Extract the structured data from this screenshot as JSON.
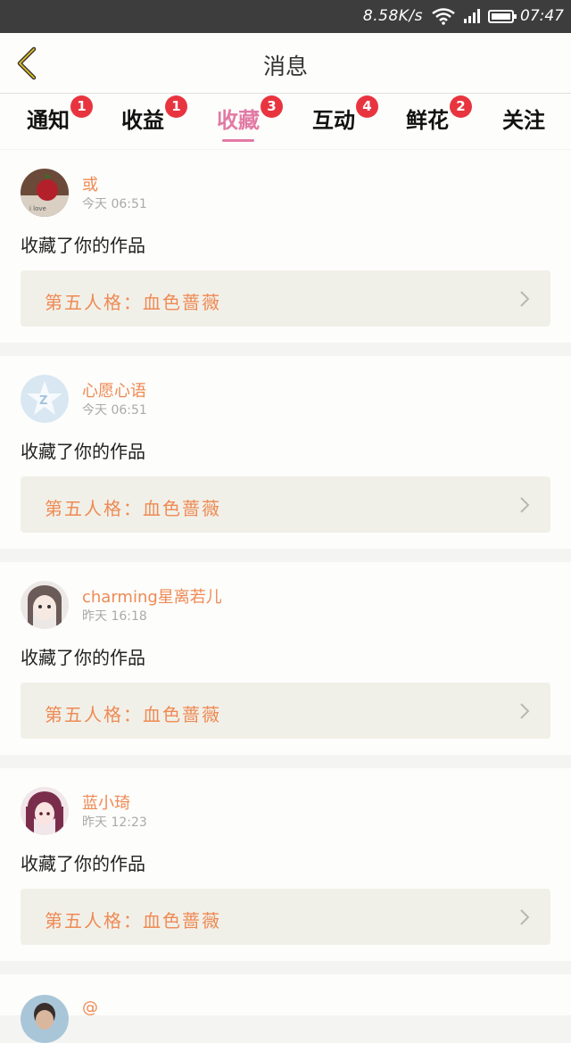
{
  "status": {
    "speed": "8.58K/s",
    "time": "07:47"
  },
  "header": {
    "title": "消息"
  },
  "tabs": [
    {
      "label": "通知",
      "badge": "1"
    },
    {
      "label": "收益",
      "badge": "1"
    },
    {
      "label": "收藏",
      "badge": "3"
    },
    {
      "label": "互动",
      "badge": "4"
    },
    {
      "label": "鲜花",
      "badge": "2"
    },
    {
      "label": "关注",
      "badge": ""
    }
  ],
  "messages": [
    {
      "user": "或",
      "time": "今天 06:51",
      "action": "收藏了你的作品",
      "work": "第五人格：血色蔷薇"
    },
    {
      "user": "心愿心语",
      "time": "今天 06:51",
      "action": "收藏了你的作品",
      "work": "第五人格：血色蔷薇"
    },
    {
      "user": "charming星离若儿",
      "time": "昨天 16:18",
      "action": "收藏了你的作品",
      "work": "第五人格：血色蔷薇"
    },
    {
      "user": "蓝小琦",
      "time": "昨天 12:23",
      "action": "收藏了你的作品",
      "work": "第五人格：血色蔷薇"
    }
  ],
  "partial": {
    "user": "@"
  },
  "colors": {
    "accent_pink": "#e27aa5",
    "accent_orange": "#ee8a55",
    "badge_red": "#e8343f"
  }
}
